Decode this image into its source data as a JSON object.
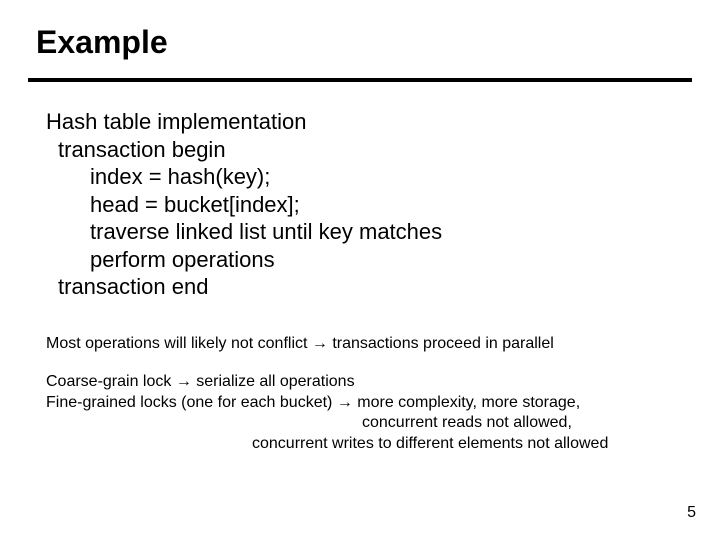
{
  "title": "Example",
  "body": {
    "l1": "Hash table implementation",
    "l2": "transaction begin",
    "l3": "index = hash(key);",
    "l4": "head = bucket[index];",
    "l5": "traverse linked list until key matches",
    "l6": "perform operations",
    "l7": "transaction end"
  },
  "notes": {
    "n1_a": "Most operations will likely not conflict ",
    "n1_b": " transactions proceed in parallel",
    "n2_a": "Coarse-grain lock ",
    "n2_b": " serialize all operations",
    "n3_a": "Fine-grained locks (one for each bucket) ",
    "n3_b": " more complexity, more storage,",
    "n4": "concurrent reads not allowed,",
    "n5": "concurrent writes to different elements not allowed"
  },
  "arrow": "→",
  "page": "5"
}
